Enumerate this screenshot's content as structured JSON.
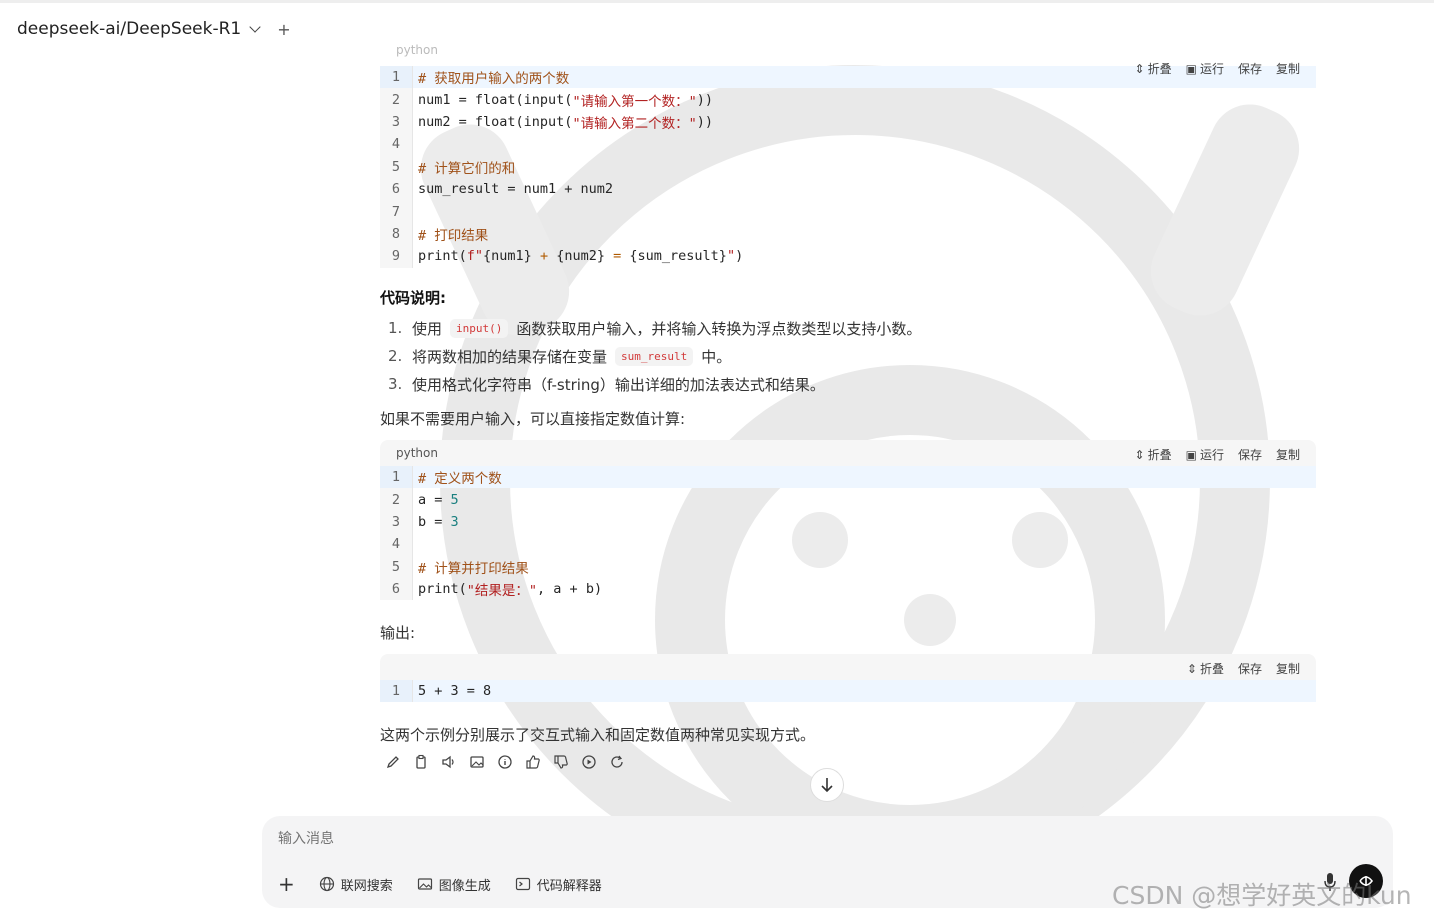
{
  "header": {
    "model_name": "deepseek-ai/DeepSeek-R1",
    "new_label": "+"
  },
  "code_actions": {
    "fold": "折叠",
    "run": "运行",
    "save": "保存",
    "copy": "复制"
  },
  "code_blocks": [
    {
      "lang": "python",
      "lines": [
        {
          "n": "1",
          "parts": [
            {
              "c": "cm",
              "t": "# 获取用户输入的两个数"
            }
          ]
        },
        {
          "n": "2",
          "parts": [
            {
              "c": "",
              "t": "num1 = float(input("
            },
            {
              "c": "st",
              "t": "\"请输入第一个数：\""
            },
            {
              "c": "",
              "t": "))"
            }
          ]
        },
        {
          "n": "3",
          "parts": [
            {
              "c": "",
              "t": "num2 = float(input("
            },
            {
              "c": "st",
              "t": "\"请输入第二个数：\""
            },
            {
              "c": "",
              "t": "))"
            }
          ]
        },
        {
          "n": "4",
          "parts": []
        },
        {
          "n": "5",
          "parts": [
            {
              "c": "cm",
              "t": "# 计算它们的和"
            }
          ]
        },
        {
          "n": "6",
          "parts": [
            {
              "c": "",
              "t": "sum_result = num1 + num2"
            }
          ]
        },
        {
          "n": "7",
          "parts": []
        },
        {
          "n": "8",
          "parts": [
            {
              "c": "cm",
              "t": "# 打印结果"
            }
          ]
        },
        {
          "n": "9",
          "parts": [
            {
              "c": "",
              "t": "print("
            },
            {
              "c": "st",
              "t": "f\""
            },
            {
              "c": "",
              "t": "{num1} "
            },
            {
              "c": "op",
              "t": "+"
            },
            {
              "c": "",
              "t": " {num2} "
            },
            {
              "c": "op",
              "t": "="
            },
            {
              "c": "",
              "t": " {sum_result}"
            },
            {
              "c": "st",
              "t": "\""
            },
            {
              "c": "",
              "t": ")"
            }
          ]
        }
      ]
    },
    {
      "lang": "python",
      "lines": [
        {
          "n": "1",
          "parts": [
            {
              "c": "cm",
              "t": "# 定义两个数"
            }
          ]
        },
        {
          "n": "2",
          "parts": [
            {
              "c": "",
              "t": "a = "
            },
            {
              "c": "nm",
              "t": "5"
            }
          ]
        },
        {
          "n": "3",
          "parts": [
            {
              "c": "",
              "t": "b = "
            },
            {
              "c": "nm",
              "t": "3"
            }
          ]
        },
        {
          "n": "4",
          "parts": []
        },
        {
          "n": "5",
          "parts": [
            {
              "c": "cm",
              "t": "# 计算并打印结果"
            }
          ]
        },
        {
          "n": "6",
          "parts": [
            {
              "c": "",
              "t": "print("
            },
            {
              "c": "st",
              "t": "\"结果是：\""
            },
            {
              "c": "",
              "t": ", a + b)"
            }
          ]
        }
      ]
    },
    {
      "lang": "",
      "lines": [
        {
          "n": "1",
          "parts": [
            {
              "c": "",
              "t": "5 + 3 = 8"
            }
          ]
        }
      ]
    }
  ],
  "explain": {
    "heading": "代码说明:",
    "items": [
      {
        "num": "1.",
        "before": "使用",
        "code": "input()",
        "after": "函数获取用户输入，并将输入转换为浮点数类型以支持小数。"
      },
      {
        "num": "2.",
        "before": "将两数相加的结果存储在变量",
        "code": "sum_result",
        "after": "中。"
      },
      {
        "num": "3.",
        "before": "使用格式化字符串（f-string）输出详细的加法表达式和结果。",
        "code": "",
        "after": ""
      }
    ]
  },
  "para_1": "如果不需要用户输入，可以直接指定数值计算:",
  "para_2": "输出:",
  "para_3": "这两个示例分别展示了交互式输入和固定数值两种常见实现方式。",
  "composer": {
    "placeholder": "输入消息",
    "tools": {
      "web_search": "联网搜索",
      "image_gen": "图像生成",
      "code_interp": "代码解释器"
    }
  },
  "watermark": "CSDN @想学好英文的kun"
}
